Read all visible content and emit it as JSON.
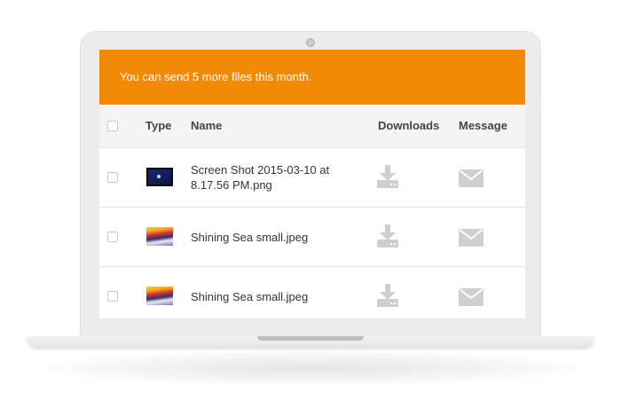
{
  "banner": {
    "text": "You can send 5 more files this month."
  },
  "table": {
    "columns": {
      "type": "Type",
      "name": "Name",
      "downloads": "Downloads",
      "message": "Message"
    },
    "rows": [
      {
        "thumbnail": "screenshot-thumbnail",
        "name": "Screen Shot 2015-03-10 at 8.17.56 PM.png",
        "download_icon": "download-icon",
        "message_icon": "envelope-icon"
      },
      {
        "thumbnail": "sunset-sea-thumbnail",
        "name": "Shining Sea small.jpeg",
        "download_icon": "download-icon",
        "message_icon": "envelope-icon"
      },
      {
        "thumbnail": "sunset-sea-thumbnail",
        "name": "Shining Sea small.jpeg",
        "download_icon": "download-icon",
        "message_icon": "envelope-icon"
      }
    ]
  },
  "colors": {
    "accent": "#f38a06",
    "icon_gray": "#cfcfcf",
    "header_bg": "#f4f4f4"
  }
}
